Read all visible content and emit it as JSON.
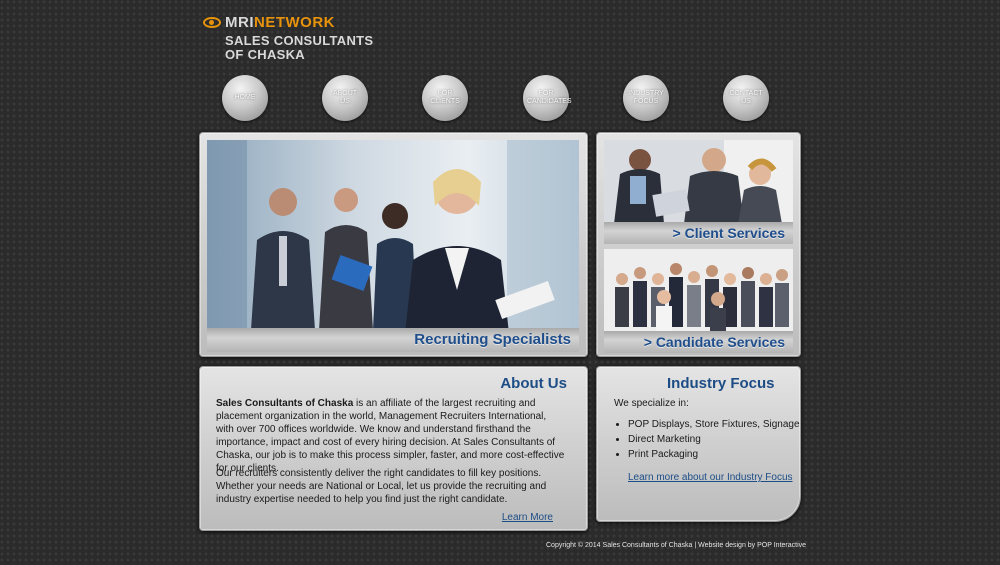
{
  "brand": {
    "logo_mri": "MRI",
    "logo_network": "NETWORK",
    "name_line1": "SALES CONSULTANTS",
    "name_line2": "OF CHASKA"
  },
  "nav": [
    {
      "label": "HOME"
    },
    {
      "label": "ABOUT\nUS"
    },
    {
      "label": "FOR\nCLIENTS"
    },
    {
      "label": "FOR\nCANDIDATES"
    },
    {
      "label": "INDUSTRY\nFOCUS"
    },
    {
      "label": "CONTACT\nUS"
    }
  ],
  "hero": {
    "caption": "Recruiting Specialists"
  },
  "client_services": {
    "caption": "> Client Services"
  },
  "candidate_services": {
    "caption": "> Candidate Services"
  },
  "about": {
    "title": "About Us",
    "p1_bold": "Sales Consultants of Chaska",
    "p1_rest": " is an affiliate of the largest recruiting and placement organization in the world, Management Recruiters International, with over 700 offices worldwide. We know and understand firsthand the importance, impact and cost of every hiring decision. At Sales Consultants of Chaska, our job is to make this process simpler, faster, and more cost-effective for our clients.",
    "p2": "Our recruiters consistently deliver the right candidates to fill key positions. Whether your needs are National or Local, let us provide the recruiting and industry expertise needed to help you find just the right candidate.",
    "link": "Learn More"
  },
  "industry": {
    "title": "Industry Focus",
    "intro": "We specialize in:",
    "items": [
      "POP Displays, Store Fixtures, Signage",
      "Direct Marketing",
      "Print Packaging"
    ],
    "link": "Learn more about our Industry Focus"
  },
  "footer": {
    "text": "Copyright © 2014 Sales Consultants of Chaska | Website design by POP Interactive"
  }
}
